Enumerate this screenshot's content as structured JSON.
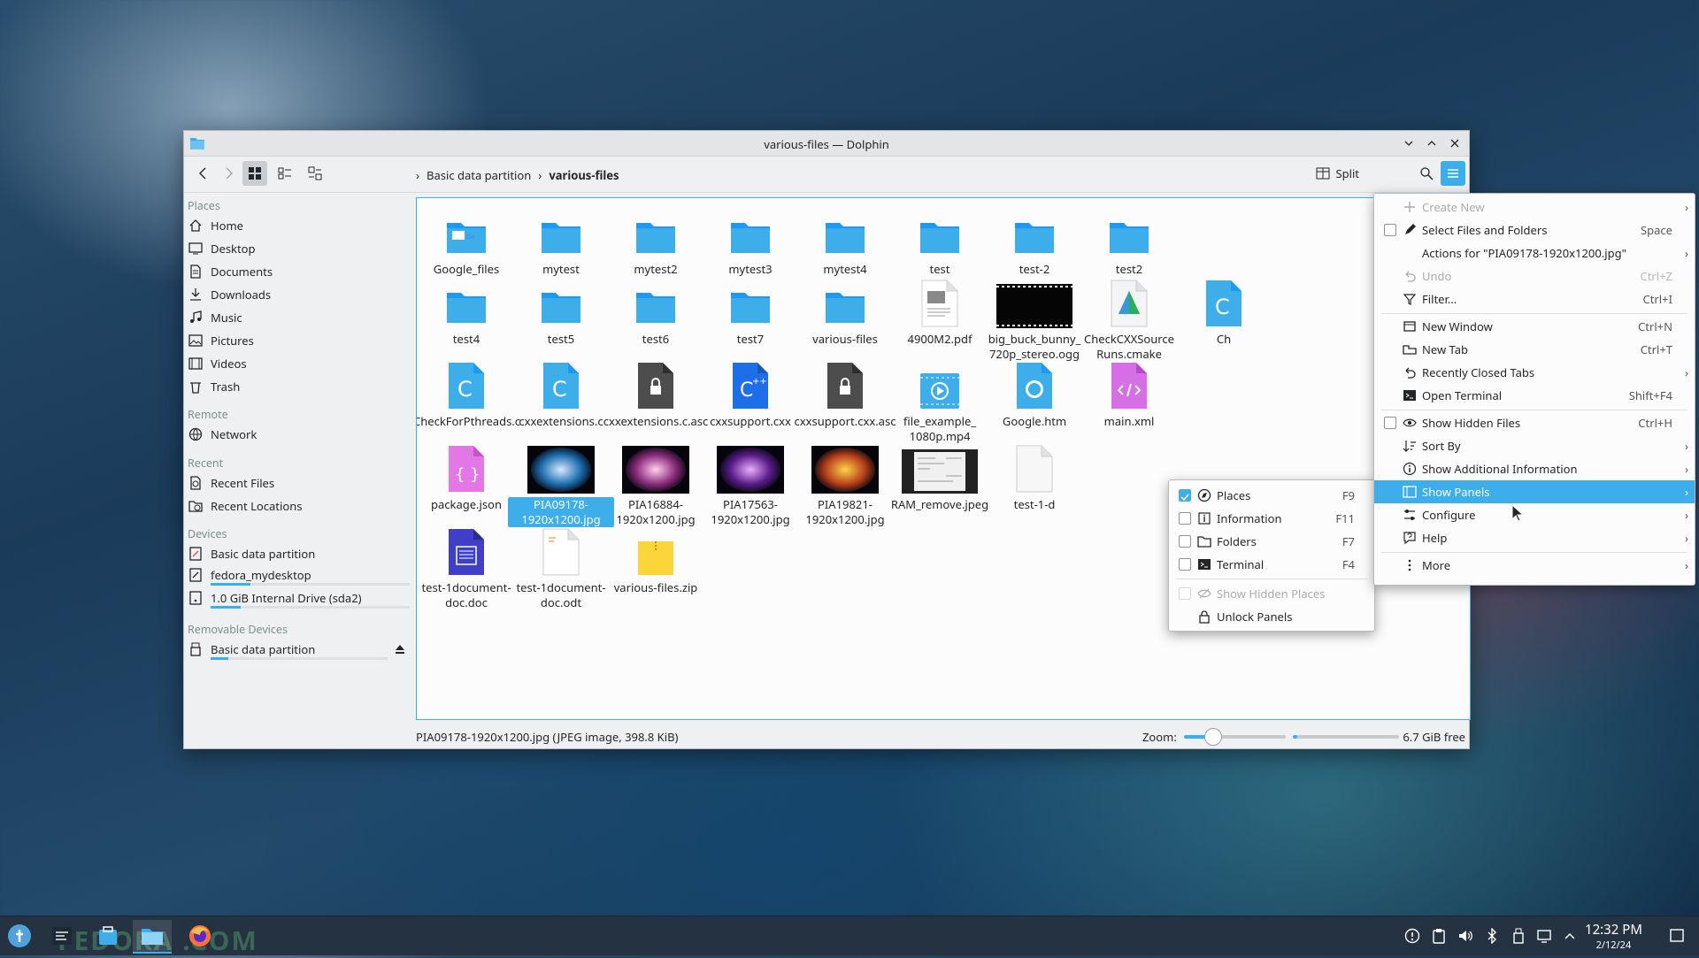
{
  "window": {
    "title": "various-files — Dolphin"
  },
  "toolbar": {
    "breadcrumb": [
      "Basic data partition",
      "various-files"
    ],
    "split_label": "Split"
  },
  "sidebar": {
    "places_header": "Places",
    "places": [
      "Home",
      "Desktop",
      "Documents",
      "Downloads",
      "Music",
      "Pictures",
      "Videos",
      "Trash"
    ],
    "remote_header": "Remote",
    "remote": [
      "Network"
    ],
    "recent_header": "Recent",
    "recent": [
      "Recent Files",
      "Recent Locations"
    ],
    "devices_header": "Devices",
    "devices": [
      "Basic data partition",
      "fedora_mydesktop",
      "1.0 GiB Internal Drive (sda2)"
    ],
    "removable_header": "Removable Devices",
    "removable": [
      "Basic data partition"
    ]
  },
  "files": [
    {
      "name": "Google_files",
      "type": "folder-web"
    },
    {
      "name": "mytest",
      "type": "folder"
    },
    {
      "name": "mytest2",
      "type": "folder"
    },
    {
      "name": "mytest3",
      "type": "folder"
    },
    {
      "name": "mytest4",
      "type": "folder"
    },
    {
      "name": "test",
      "type": "folder"
    },
    {
      "name": "test-2",
      "type": "folder"
    },
    {
      "name": "test2",
      "type": "folder"
    },
    {
      "name": "test4",
      "type": "folder"
    },
    {
      "name": "test5",
      "type": "folder"
    },
    {
      "name": "test6",
      "type": "folder"
    },
    {
      "name": "test7",
      "type": "folder"
    },
    {
      "name": "various-files",
      "type": "folder"
    },
    {
      "name": "4900M2.pdf",
      "type": "pdf"
    },
    {
      "name": "big_buck_bunny_ 720p_stereo.ogg",
      "type": "video-thumb"
    },
    {
      "name": "CheckCXXSource Runs.cmake",
      "type": "cmake"
    },
    {
      "name": "CheckForPthreads.c",
      "type": "c-source"
    },
    {
      "name": "cxxextensions.c",
      "type": "c-source"
    },
    {
      "name": "cxxextensions.c.asc",
      "type": "signature"
    },
    {
      "name": "cxxsupport.cxx",
      "type": "cpp-source"
    },
    {
      "name": "cxxsupport.cxx.asc",
      "type": "signature"
    },
    {
      "name": "file_example_ 1080p.mp4",
      "type": "video"
    },
    {
      "name": "Google.htm",
      "type": "html"
    },
    {
      "name": "main.xml",
      "type": "xml"
    },
    {
      "name": "package.json",
      "type": "json"
    },
    {
      "name": "PIA09178- 1920x1200.jpg",
      "type": "image-nebula-blue",
      "selected": true
    },
    {
      "name": "PIA16884- 1920x1200.jpg",
      "type": "image-nebula-pink"
    },
    {
      "name": "PIA17563- 1920x1200.jpg",
      "type": "image-nebula-purple"
    },
    {
      "name": "PIA19821- 1920x1200.jpg",
      "type": "image-nebula-orange"
    },
    {
      "name": "RAM_remove.jpeg",
      "type": "image-doc"
    },
    {
      "name": "test-1-d",
      "type": "document"
    },
    {
      "name": "test-1document- doc.doc",
      "type": "word-doc"
    },
    {
      "name": "test-1document- doc.odt",
      "type": "odt"
    },
    {
      "name": "various-files.zip",
      "type": "zip"
    },
    {
      "name": "Ch",
      "type": "c-source"
    }
  ],
  "status": {
    "selection": "PIA09178-1920x1200.jpg (JPEG image, 398.8 KiB)",
    "zoom_label": "Zoom:",
    "free_space": "6.7 GiB free"
  },
  "main_menu": [
    {
      "label": "Create New",
      "shortcut": "",
      "disabled": true,
      "submenu": true,
      "icon": "plus-icon"
    },
    {
      "label": "Select Files and Folders",
      "shortcut": "Space",
      "checkbox": true,
      "icon": "pen-icon"
    },
    {
      "label": "Actions for \"PIA09178-1920x1200.jpg\"",
      "shortcut": "",
      "submenu": true
    },
    {
      "label": "Undo",
      "shortcut": "Ctrl+Z",
      "disabled": true,
      "icon": "undo-icon"
    },
    {
      "label": "Filter...",
      "shortcut": "Ctrl+I",
      "icon": "filter-icon"
    },
    {
      "label": "New Window",
      "shortcut": "Ctrl+N",
      "icon": "window-icon"
    },
    {
      "label": "New Tab",
      "shortcut": "Ctrl+T",
      "icon": "tab-icon"
    },
    {
      "label": "Recently Closed Tabs",
      "shortcut": "",
      "submenu": true,
      "icon": "undo-icon"
    },
    {
      "label": "Open Terminal",
      "shortcut": "Shift+F4",
      "icon": "terminal-icon"
    },
    {
      "label": "Show Hidden Files",
      "shortcut": "Ctrl+H",
      "checkbox": true,
      "icon": "eye-icon"
    },
    {
      "label": "Sort By",
      "shortcut": "",
      "submenu": true,
      "icon": "sort-icon"
    },
    {
      "label": "Show Additional Information",
      "shortcut": "",
      "submenu": true,
      "icon": "info-icon"
    },
    {
      "label": "Show Panels",
      "shortcut": "",
      "submenu": true,
      "highlight": true,
      "icon": "panels-icon"
    },
    {
      "label": "Configure",
      "shortcut": "",
      "submenu": true,
      "icon": "configure-icon"
    },
    {
      "label": "Help",
      "shortcut": "",
      "submenu": true,
      "icon": "help-icon"
    },
    {
      "label": "More",
      "shortcut": "",
      "submenu": true,
      "icon": "more-icon"
    }
  ],
  "panels_menu": [
    {
      "label": "Places",
      "shortcut": "F9",
      "checked": true,
      "icon": "places-icon"
    },
    {
      "label": "Information",
      "shortcut": "F11",
      "checked": false,
      "icon": "information-icon"
    },
    {
      "label": "Folders",
      "shortcut": "F7",
      "checked": false,
      "icon": "folder-icon"
    },
    {
      "label": "Terminal",
      "shortcut": "F4",
      "checked": false,
      "icon": "terminal-icon"
    },
    {
      "label": "Show Hidden Places",
      "disabled": true,
      "icon": "hidden-icon"
    },
    {
      "label": "Unlock Panels",
      "icon": "lock-icon"
    }
  ],
  "taskbar": {
    "clock_time": "12:32 PM",
    "clock_date": "2/12/24",
    "watermark": "FEDORA .COM"
  },
  "colors": {
    "accent": "#3daee9",
    "folder": "#3daee9",
    "taskbar": "#243241"
  }
}
